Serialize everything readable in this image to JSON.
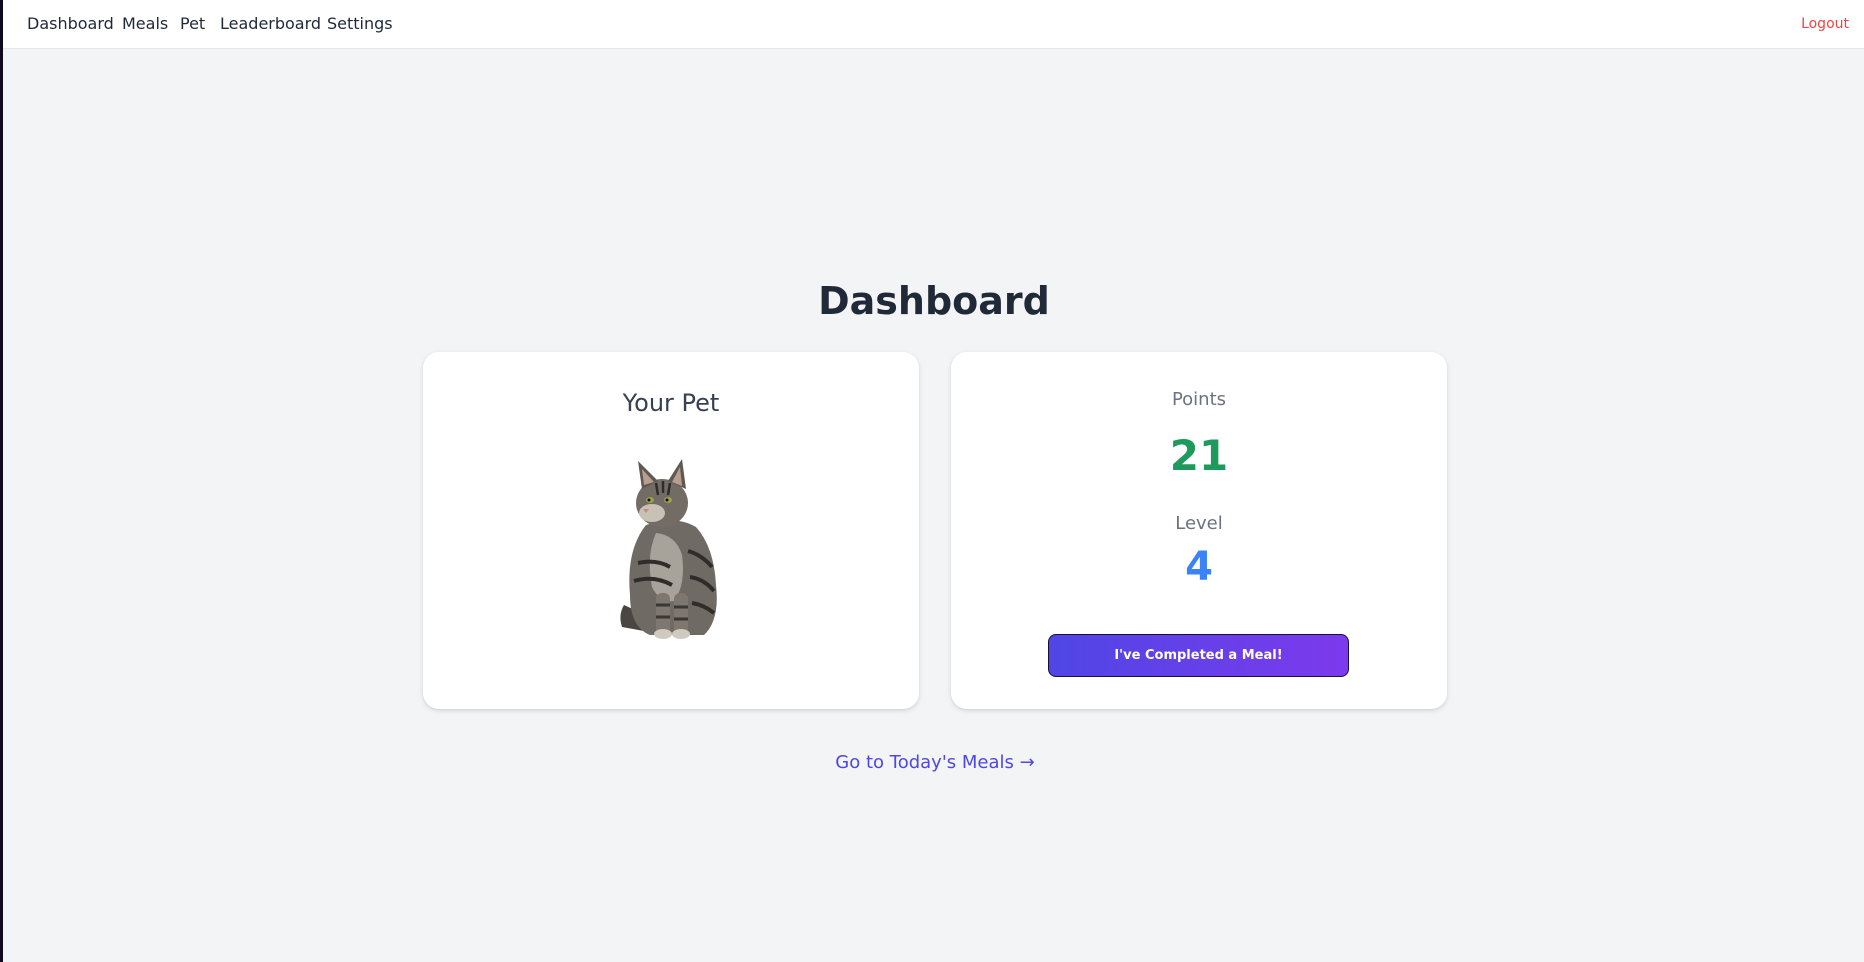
{
  "nav": {
    "items": [
      {
        "label": "Dashboard"
      },
      {
        "label": "Meals"
      },
      {
        "label": "Pet"
      },
      {
        "label": "Leaderboard"
      },
      {
        "label": "Settings"
      }
    ],
    "logout_label": "Logout"
  },
  "page": {
    "title": "Dashboard"
  },
  "pet_card": {
    "title": "Your Pet",
    "pet_icon": "cat-icon"
  },
  "stats_card": {
    "points_label": "Points",
    "points_value": "21",
    "level_label": "Level",
    "level_value": "4",
    "meal_button_label": "I've Completed a Meal!"
  },
  "meals_link_label": "Go to Today's Meals →",
  "colors": {
    "points": "#1e9a5c",
    "level": "#3b82f6",
    "link": "#4f46e5",
    "logout": "#ef4444",
    "button_start": "#4f46e5",
    "button_end": "#7c3aed"
  }
}
